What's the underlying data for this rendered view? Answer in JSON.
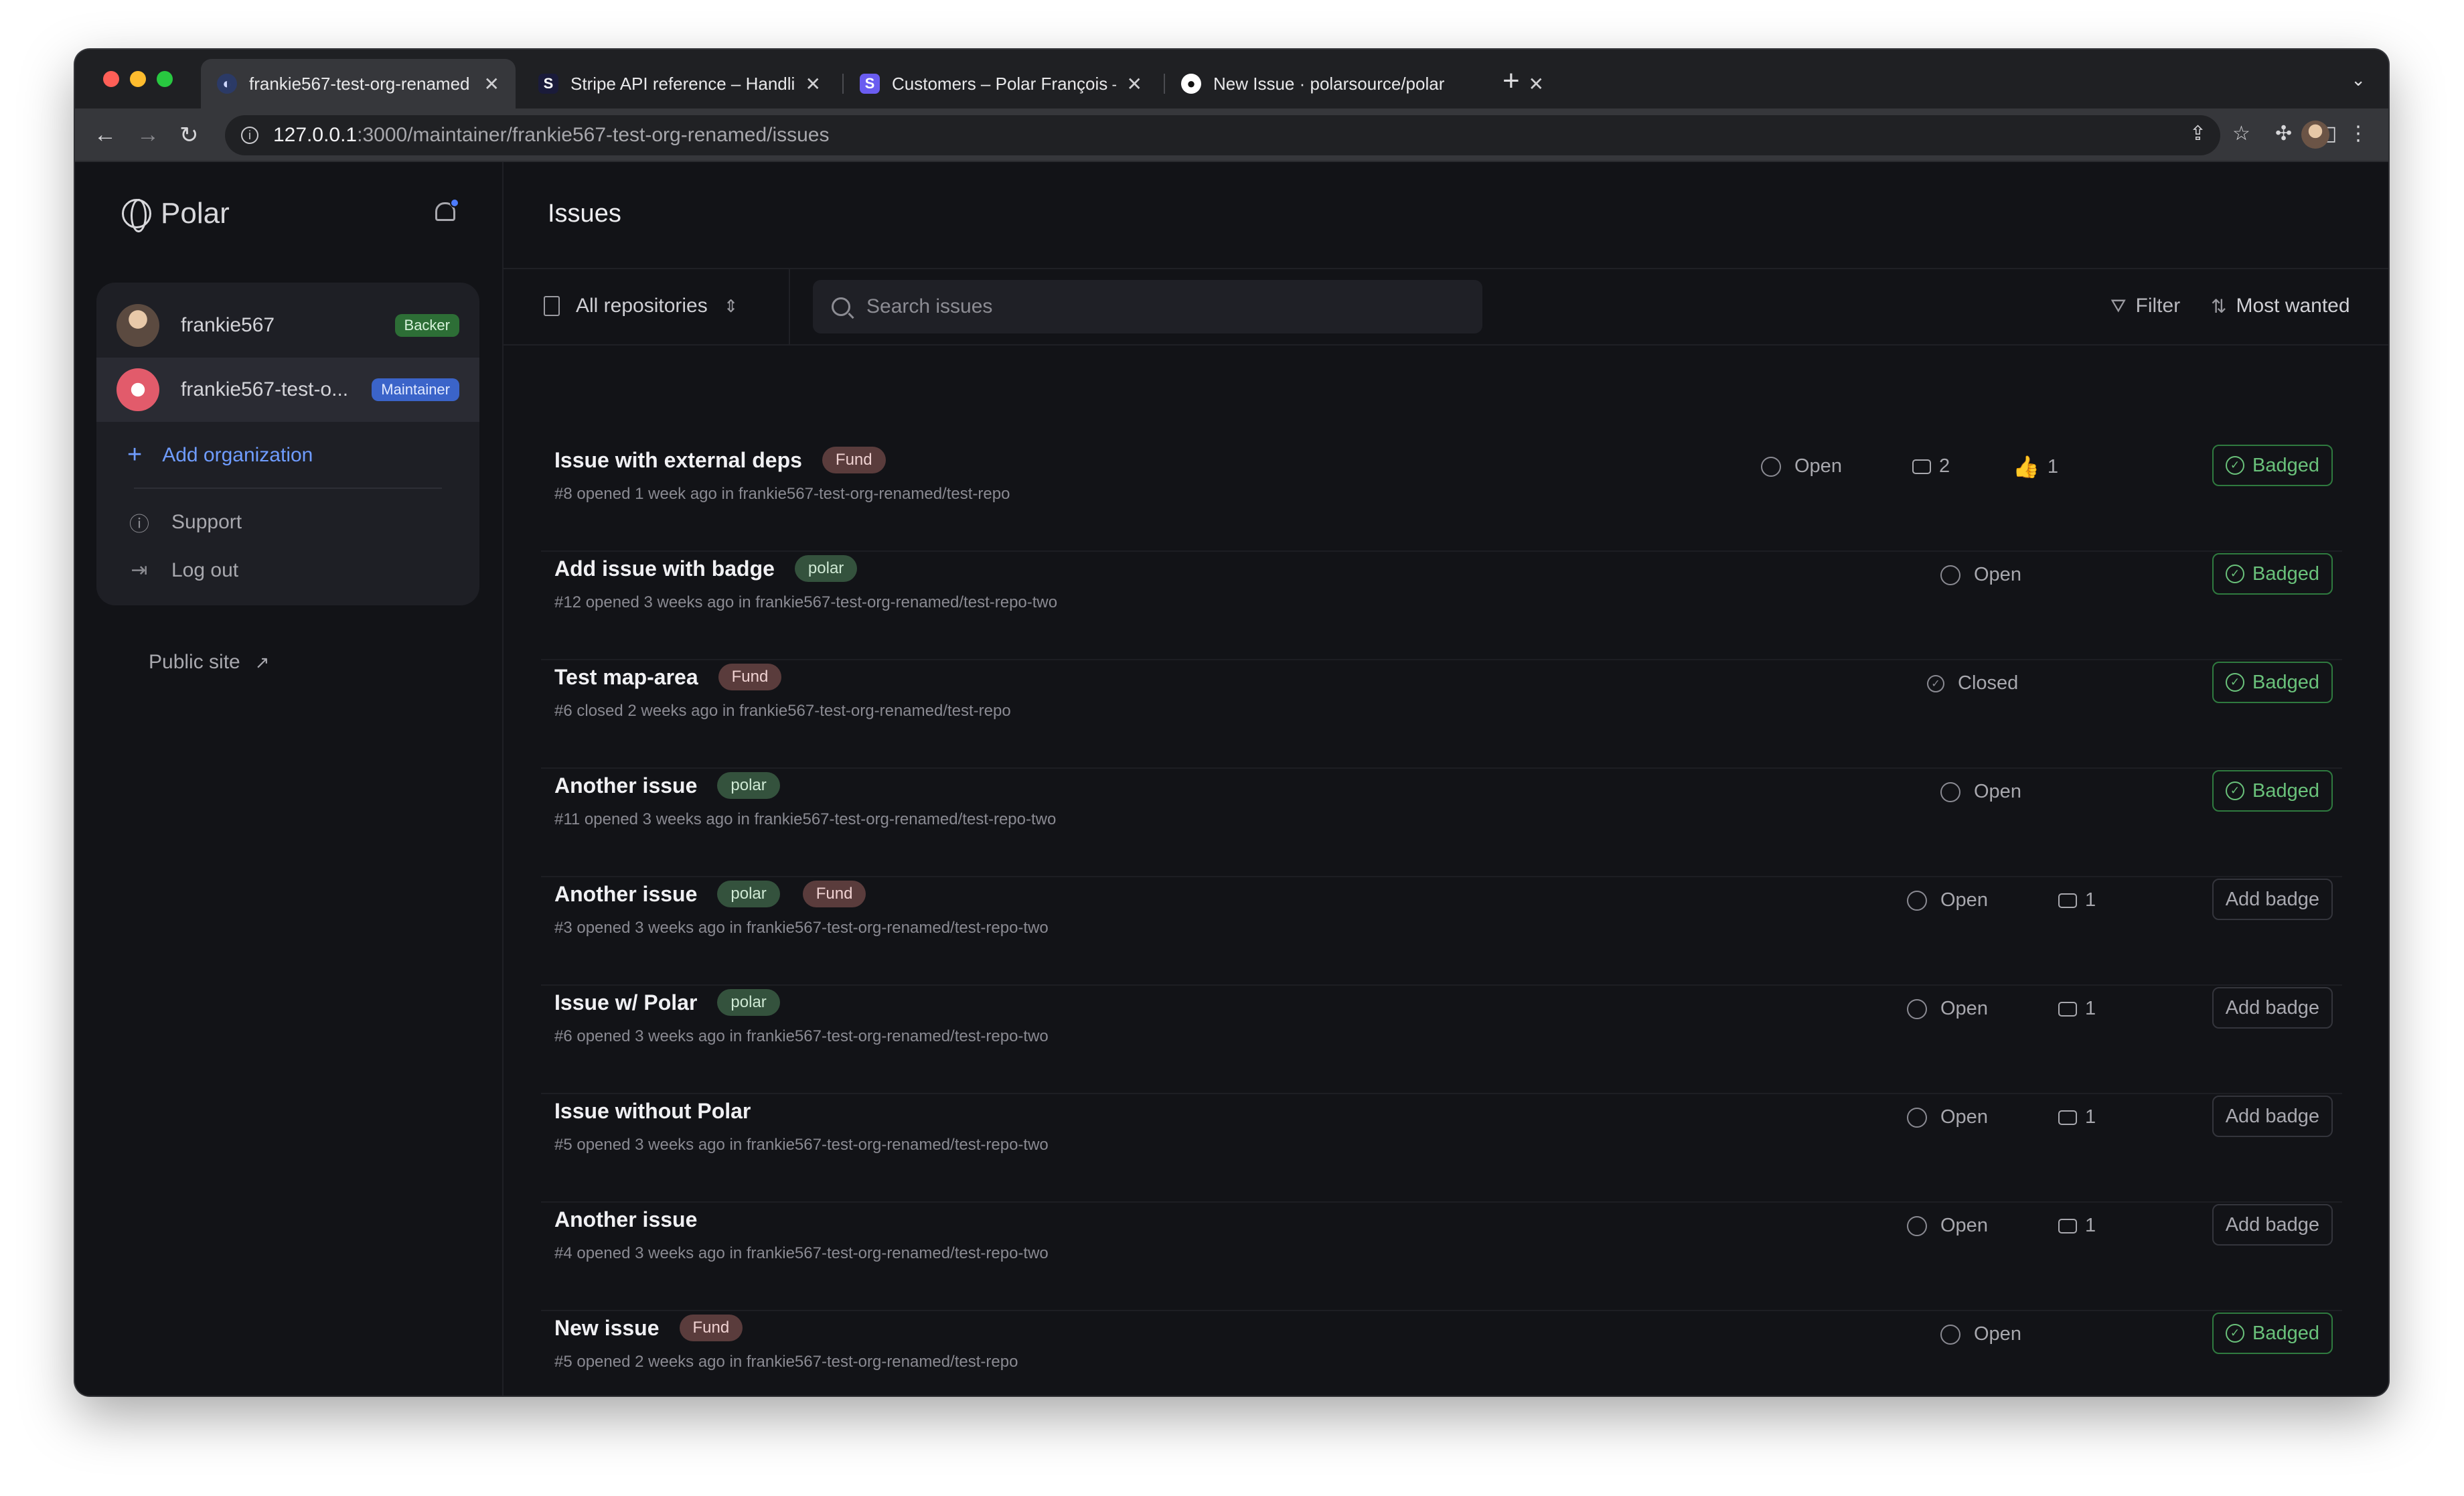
{
  "browser": {
    "tabs": [
      {
        "title": "frankie567-test-org-renamed",
        "favicon": "P",
        "active": true
      },
      {
        "title": "Stripe API reference – Handlin",
        "favicon": "S",
        "active": false
      },
      {
        "title": "Customers – Polar François –",
        "favicon": "S",
        "active": false
      },
      {
        "title": "New Issue · polarsource/polar",
        "favicon": "gh",
        "active": false
      }
    ],
    "url_host": "127.0.0.1",
    "url_path": ":3000/maintainer/frankie567-test-org-renamed/issues"
  },
  "sidebar": {
    "logo_text": "Polar",
    "orgs": [
      {
        "name": "frankie567",
        "role": "Backer"
      },
      {
        "name": "frankie567-test-o...",
        "role": "Maintainer"
      }
    ],
    "add_org_label": "Add organization",
    "support_label": "Support",
    "logout_label": "Log out",
    "public_site_label": "Public site"
  },
  "main": {
    "title": "Issues",
    "repo_selector": "All repositories",
    "search_placeholder": "Search issues",
    "filter_label": "Filter",
    "sort_label": "Most wanted"
  },
  "issues": [
    {
      "title": "Issue with external deps",
      "labels": [
        "Fund"
      ],
      "sub": "#8 opened 1 week ago in frankie567-test-org-renamed/test-repo",
      "state": "Open",
      "comments": "2",
      "reactions": "1",
      "badge": "Badged"
    },
    {
      "title": "Add issue with badge",
      "labels": [
        "polar"
      ],
      "sub": "#12 opened 3 weeks ago in frankie567-test-org-renamed/test-repo-two",
      "state": "Open",
      "comments": "",
      "reactions": "",
      "badge": "Badged"
    },
    {
      "title": "Test map-area",
      "labels": [
        "Fund"
      ],
      "sub": "#6 closed 2 weeks ago in frankie567-test-org-renamed/test-repo",
      "state": "Closed",
      "comments": "",
      "reactions": "",
      "badge": "Badged"
    },
    {
      "title": "Another issue",
      "labels": [
        "polar"
      ],
      "sub": "#11 opened 3 weeks ago in frankie567-test-org-renamed/test-repo-two",
      "state": "Open",
      "comments": "",
      "reactions": "",
      "badge": "Badged"
    },
    {
      "title": "Another issue",
      "labels": [
        "polar",
        "Fund"
      ],
      "sub": "#3 opened 3 weeks ago in frankie567-test-org-renamed/test-repo-two",
      "state": "Open",
      "comments": "1",
      "reactions": "",
      "badge": "Add badge"
    },
    {
      "title": "Issue w/ Polar",
      "labels": [
        "polar"
      ],
      "sub": "#6 opened 3 weeks ago in frankie567-test-org-renamed/test-repo-two",
      "state": "Open",
      "comments": "1",
      "reactions": "",
      "badge": "Add badge"
    },
    {
      "title": "Issue without Polar",
      "labels": [],
      "sub": "#5 opened 3 weeks ago in frankie567-test-org-renamed/test-repo-two",
      "state": "Open",
      "comments": "1",
      "reactions": "",
      "badge": "Add badge"
    },
    {
      "title": "Another issue",
      "labels": [],
      "sub": "#4 opened 3 weeks ago in frankie567-test-org-renamed/test-repo-two",
      "state": "Open",
      "comments": "1",
      "reactions": "",
      "badge": "Add badge"
    },
    {
      "title": "New issue",
      "labels": [
        "Fund"
      ],
      "sub": "#5 opened 2 weeks ago in frankie567-test-org-renamed/test-repo",
      "state": "Open",
      "comments": "",
      "reactions": "",
      "badge": "Badged"
    }
  ],
  "colors": {
    "accent": "#6f9cff",
    "badged": "#6ac27b",
    "backer": "#2d6e36",
    "maintainer": "#3b64c9"
  }
}
